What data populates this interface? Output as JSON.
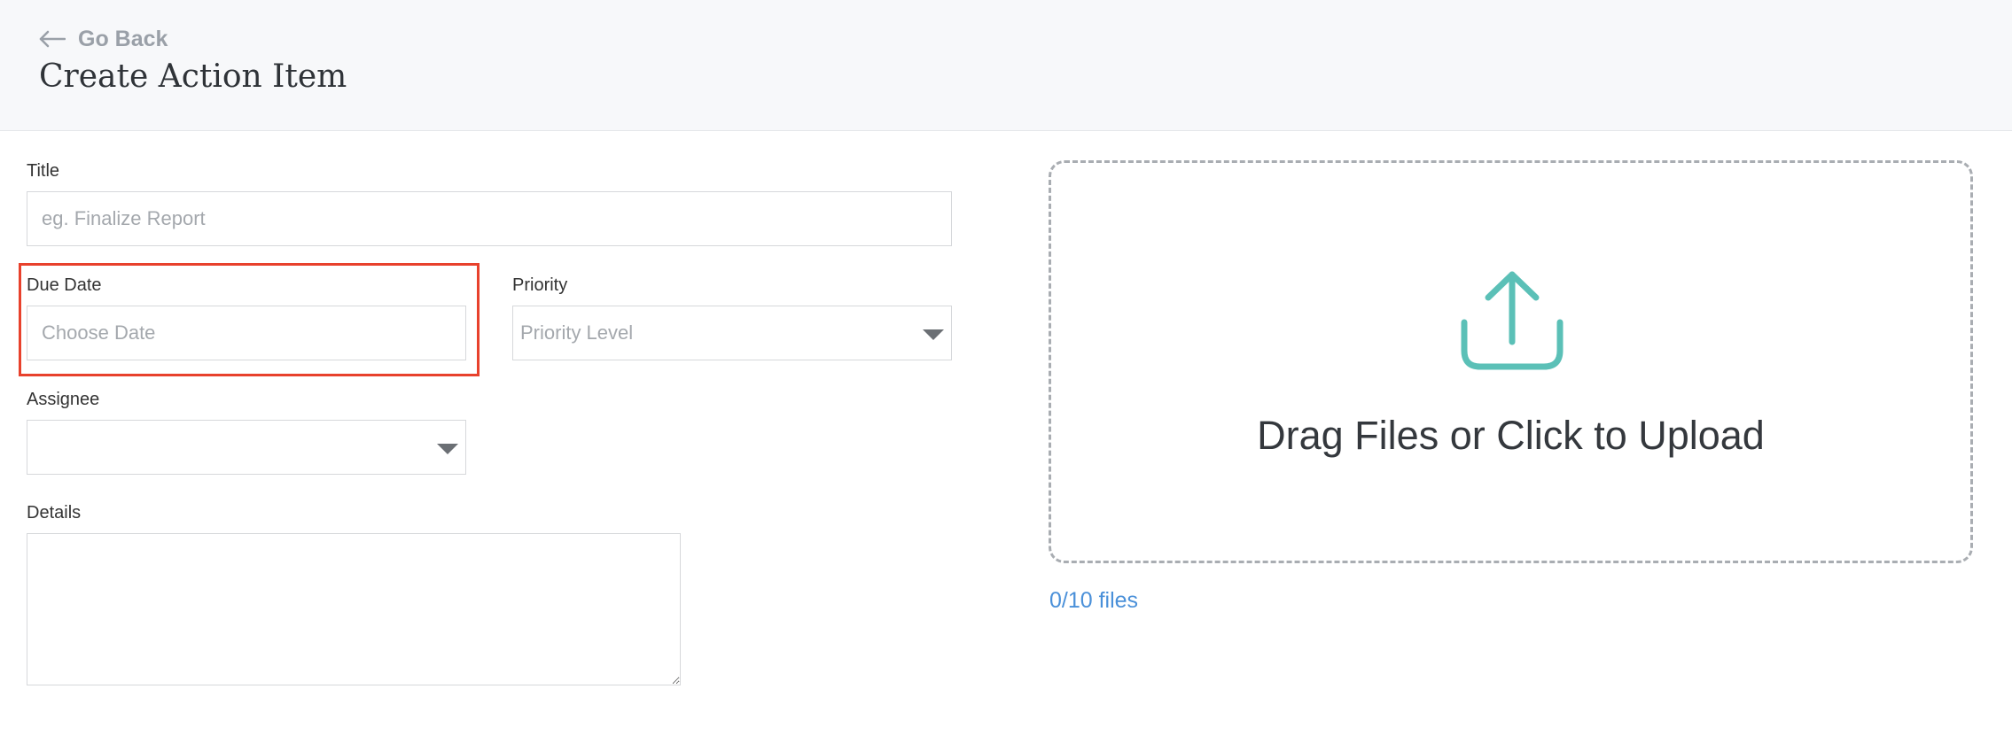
{
  "header": {
    "back_label": "Go Back",
    "title": "Create Action Item"
  },
  "form": {
    "title": {
      "label": "Title",
      "placeholder": "eg. Finalize Report",
      "value": ""
    },
    "due_date": {
      "label": "Due Date",
      "placeholder": "Choose Date",
      "value": ""
    },
    "priority": {
      "label": "Priority",
      "selected": "Priority Level"
    },
    "assignee": {
      "label": "Assignee",
      "selected": ""
    },
    "details": {
      "label": "Details",
      "value": ""
    }
  },
  "upload": {
    "prompt": "Drag Files or Click to Upload",
    "files_count": "0/10 files",
    "icon": "upload-icon"
  },
  "colors": {
    "accent": "#5bc0b7",
    "link": "#4a90d9",
    "highlight": "#e8412c",
    "header_bg": "#f7f8fa"
  }
}
